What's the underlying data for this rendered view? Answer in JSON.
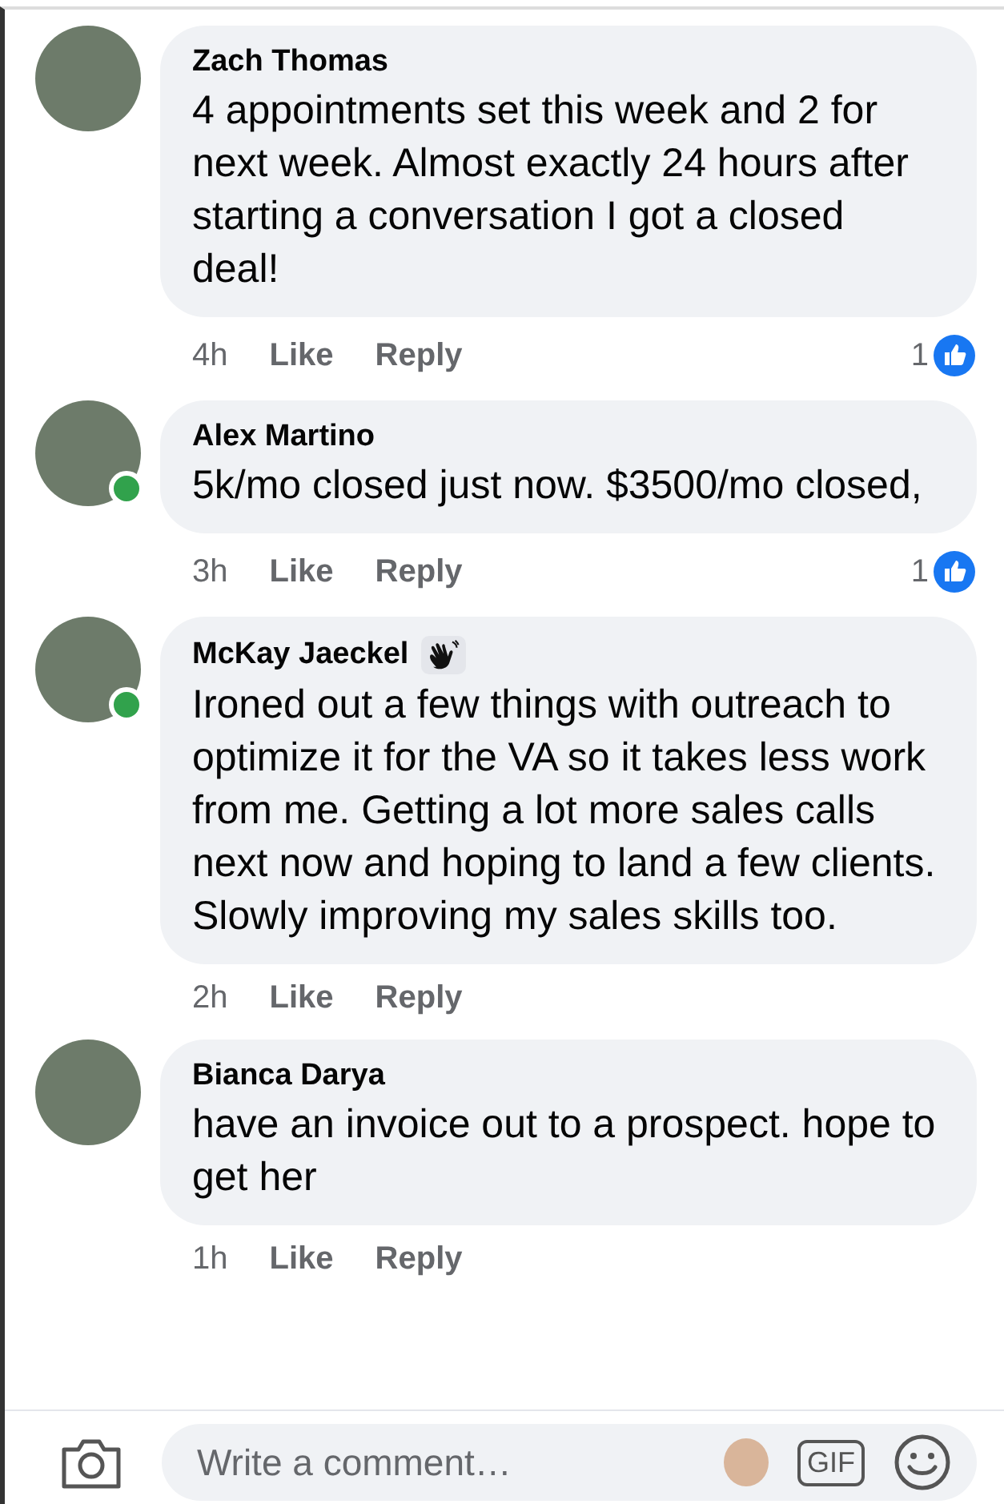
{
  "comments": [
    {
      "name": "Zach Thomas",
      "online": false,
      "wave_badge": false,
      "text": "4 appointments set this week and 2 for next week. Almost exactly 24 hours after starting a conversation I got a closed deal!",
      "time": "4h",
      "like_label": "Like",
      "reply_label": "Reply",
      "likes": "1"
    },
    {
      "name": "Alex Martino",
      "online": true,
      "wave_badge": false,
      "text": "5k/mo closed just now. $3500/mo closed,",
      "time": "3h",
      "like_label": "Like",
      "reply_label": "Reply",
      "likes": "1"
    },
    {
      "name": "McKay Jaeckel",
      "online": true,
      "wave_badge": true,
      "text": "Ironed out a few things with outreach to optimize it for the VA so it takes less work from me. Getting a lot more sales calls next now and hoping to land a few clients. Slowly improving my sales skills too.",
      "time": "2h",
      "like_label": "Like",
      "reply_label": "Reply"
    },
    {
      "name": "Bianca Darya",
      "online": false,
      "wave_badge": false,
      "text": "have an invoice out to a prospect. hope to get her",
      "time": "1h",
      "like_label": "Like",
      "reply_label": "Reply"
    }
  ],
  "composer": {
    "placeholder": "Write a comment…",
    "gif_label": "GIF"
  }
}
